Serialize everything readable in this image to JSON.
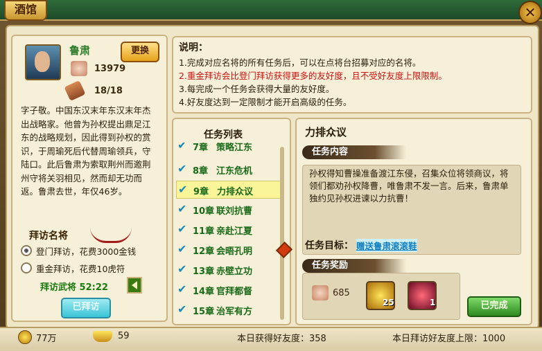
{
  "window": {
    "title": "酒馆",
    "close_icon": "close-icon"
  },
  "general": {
    "name": "鲁肃",
    "change_label": "更换",
    "friendship": "13979",
    "visits": "18/18",
    "bio": "字子敬。中国东汉末年东汉末年杰出战略家。他曾为孙权提出鼎足江东的战略规划，因此得到孙权的赏识，于周瑜死后代替周瑜领兵，守陆口。此后鲁肃为索取荆州而邀荆州守将关羽相见，然而却无功而返。鲁肃去世，年仅46岁。"
  },
  "visit": {
    "title": "拜访名将",
    "options": [
      {
        "label": "登门拜访，花费3000金钱",
        "selected": true
      },
      {
        "label": "重金拜访，花费10虎符",
        "selected": false
      }
    ],
    "timer_label": "拜访武将",
    "timer_value": "52:22",
    "visited_button": "已拜访"
  },
  "description": {
    "title": "说明：",
    "lines": [
      {
        "text": "1.完成对应名将的所有任务后，可以在点将台招募对应的名将。",
        "red": false
      },
      {
        "text": "2.重金拜访会比登门拜访获得更多的友好度，且不受好友度上限限制。",
        "red": true
      },
      {
        "text": "3.每完成一个任务会获得大量的友好度。",
        "red": false
      },
      {
        "text": "4.好友度达到一定限制才能开启高级的任务。",
        "red": false
      }
    ]
  },
  "task_list": {
    "title": "任务列表",
    "items": [
      {
        "chapter": "7章",
        "name": "策略江东",
        "done": true,
        "selected": false
      },
      {
        "chapter": "8章",
        "name": "江东危机",
        "done": true,
        "selected": false
      },
      {
        "chapter": "9章",
        "name": "力排众议",
        "done": true,
        "selected": true
      },
      {
        "chapter": "10章",
        "name": "联刘抗曹",
        "done": true,
        "selected": false
      },
      {
        "chapter": "11章",
        "name": "亲赴江夏",
        "done": true,
        "selected": false
      },
      {
        "chapter": "12章",
        "name": "会晤孔明",
        "done": true,
        "selected": false
      },
      {
        "chapter": "13章",
        "name": "赤壁立功",
        "done": true,
        "selected": false
      },
      {
        "chapter": "14章",
        "name": "官拜都督",
        "done": true,
        "selected": false
      },
      {
        "chapter": "15章",
        "name": "治军有方",
        "done": true,
        "selected": false
      }
    ]
  },
  "task_detail": {
    "title": "力排众议",
    "content_banner": "任务内容",
    "content": "孙权得知曹操准备渡江东侵，召集众位将领商议，将领们都劝孙权降曹，唯鲁肃不发一言。后来，鲁肃单独约见孙权进谏以力抗曹！",
    "goal_label": "任务目标：",
    "goal_value": "赠送鲁肃滚滚鞋",
    "reward_banner": "任务奖励",
    "reward_friendship": "685",
    "reward_items": [
      {
        "icon": "gold-ingot-icon",
        "count": "25"
      },
      {
        "icon": "red-gem-icon",
        "count": "1"
      }
    ],
    "done_button": "已完成"
  },
  "footer": {
    "coins": "77万",
    "ingots": "59",
    "today_friendship": "本日获得好友度：358",
    "today_limit": "本日拜访好友度上限：1000"
  }
}
